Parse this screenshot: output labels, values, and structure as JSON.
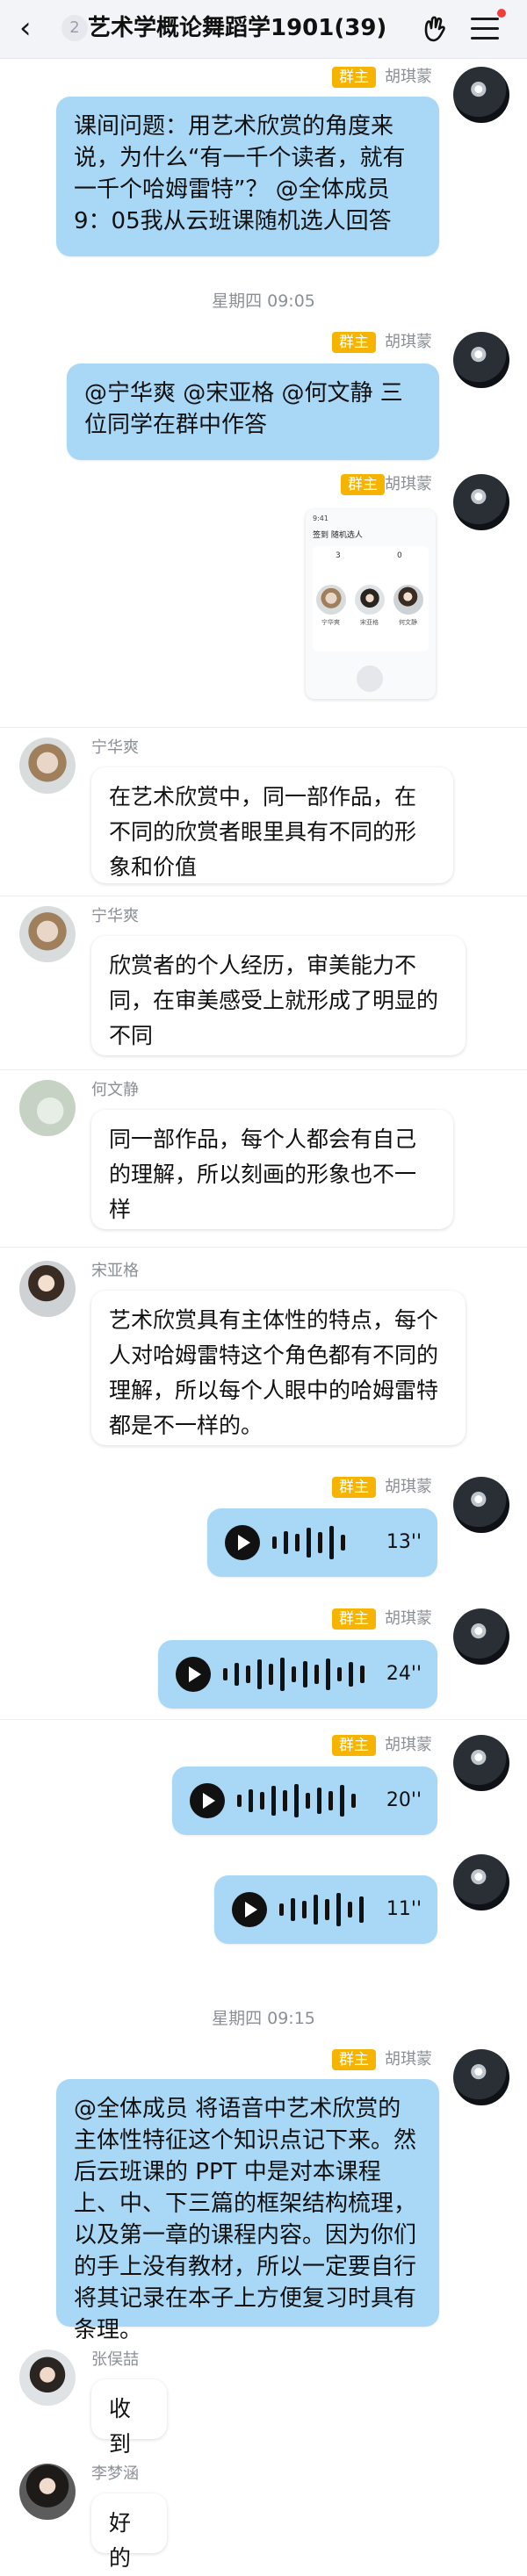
{
  "header": {
    "badge": "2",
    "title": "艺术学概论舞蹈学1901(39)",
    "icons": [
      "back-arrow-icon",
      "hand-gesture-icon",
      "menu-icon"
    ]
  },
  "owner_badge": "群主",
  "owner_name": "胡琪蒙",
  "messages": {
    "m1": "课间问题：用艺术欣赏的角度来说，为什么“有一千个读者，就有一千个哈姆雷特”？ @全体成员 9：05我从云班课随机选人回答",
    "ts1": "星期四 09:05",
    "m2": "@宁华爽 @宋亚格 @何文静 三位同学在群中作答",
    "shot": {
      "status": "9:41",
      "tabs": "签到   随机选人",
      "num_left": "3",
      "num_right": "0",
      "names": [
        "宁华爽",
        "宋亚格",
        "何文静"
      ]
    },
    "m4_sender": "宁华爽",
    "m4": "在艺术欣赏中，同一部作品，在不同的欣赏者眼里具有不同的形象和价值",
    "m5_sender": "宁华爽",
    "m5": "欣赏者的个人经历，审美能力不同，在审美感受上就形成了明显的不同",
    "m6_sender": "何文静",
    "m6": "同一部作品，每个人都会有自己的理解，所以刻画的形象也不一样",
    "m7_sender": "宋亚格",
    "m7": "艺术欣赏具有主体性的特点，每个人对哈姆雷特这个角色都有不同的理解，所以每个人眼中的哈姆雷特都是不一样的。",
    "v1": "13''",
    "v2": "24''",
    "v3": "20''",
    "v4": "11''",
    "ts2": "星期四 09:15",
    "m12": "@全体成员 将语音中艺术欣赏的主体性特征这个知识点记下来。然后云班课的 PPT 中是对本课程上、中、下三篇的框架结构梳理，以及第一章的课程内容。因为你们的手上没有教材，所以一定要自行将其记录在本子上方便复习时具有条理。",
    "m13_sender": "张俣喆",
    "m13": "收到",
    "m14_sender": "李梦涵",
    "m14": "好的"
  }
}
